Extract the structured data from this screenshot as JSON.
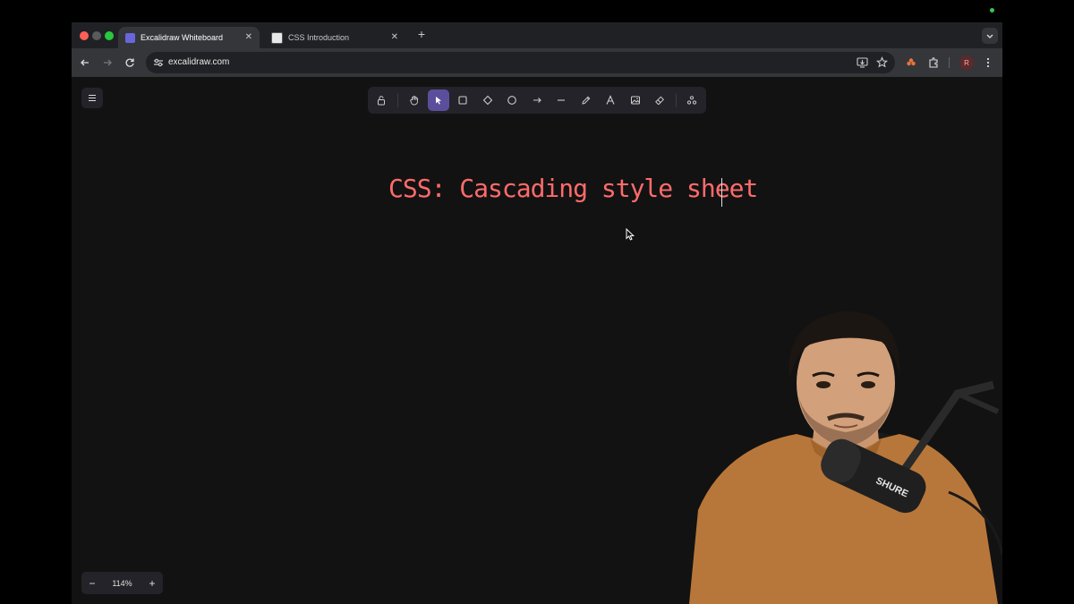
{
  "browser": {
    "tabs": [
      {
        "title": "Excalidraw Whiteboard",
        "active": true
      },
      {
        "title": "CSS Introduction",
        "active": false
      }
    ],
    "new_tab_label": "+",
    "url": "excalidraw.com",
    "profile_initial": "R"
  },
  "excalidraw": {
    "toolbar_icons": [
      "lock-icon",
      "hand-icon",
      "selection-icon",
      "rectangle-icon",
      "diamond-icon",
      "ellipse-icon",
      "arrow-icon",
      "line-icon",
      "pencil-icon",
      "text-icon",
      "image-icon",
      "eraser-icon",
      "library-icon"
    ],
    "selected_tool": "selection",
    "canvas_text": "CSS: Cascading style sheet",
    "canvas_text_color": "#ff6b6b",
    "zoom": {
      "minus": "−",
      "value": "114%",
      "plus": "+"
    }
  },
  "colors": {
    "canvas_bg": "#121212",
    "selected_tool_bg": "#5b4f9c",
    "mic_brand": "SHURE"
  }
}
